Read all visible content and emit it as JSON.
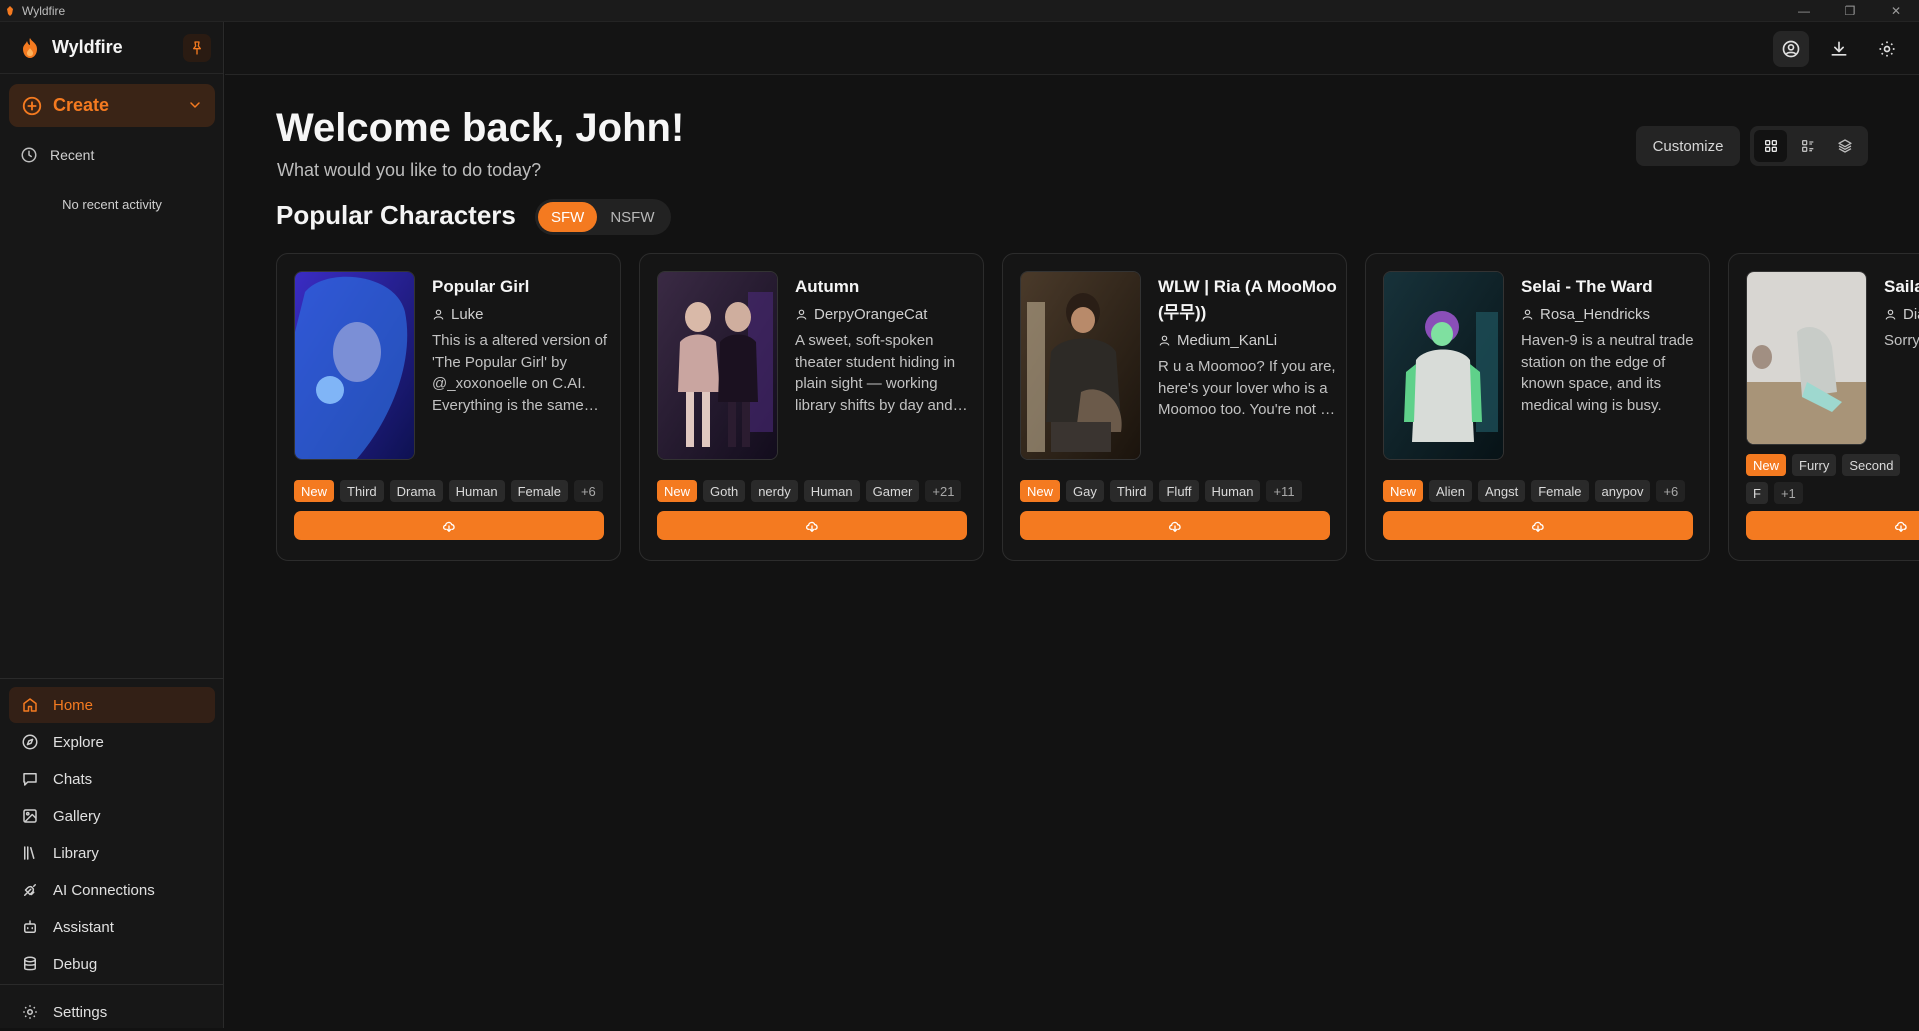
{
  "window": {
    "title": "Wyldfire",
    "controls": [
      "—",
      "❐",
      "✕"
    ]
  },
  "sidebar": {
    "brand": "Wyldfire",
    "create_label": "Create",
    "recent_label": "Recent",
    "no_recent": "No recent activity",
    "nav": [
      {
        "label": "Home",
        "icon": "home-icon",
        "active": true
      },
      {
        "label": "Explore",
        "icon": "compass-icon",
        "active": false
      },
      {
        "label": "Chats",
        "icon": "chat-icon",
        "active": false
      },
      {
        "label": "Gallery",
        "icon": "image-icon",
        "active": false
      },
      {
        "label": "Library",
        "icon": "library-icon",
        "active": false
      },
      {
        "label": "AI Connections",
        "icon": "plug-icon",
        "active": false
      },
      {
        "label": "Assistant",
        "icon": "bot-icon",
        "active": false
      },
      {
        "label": "Debug",
        "icon": "database-icon",
        "active": false
      }
    ],
    "settings_label": "Settings"
  },
  "main": {
    "welcome": "Welcome back, John!",
    "subtitle": "What would you like to do today?",
    "customize_label": "Customize",
    "section_title": "Popular Characters",
    "filters": {
      "sfw": "SFW",
      "nsfw": "NSFW",
      "active": "SFW"
    },
    "cards": [
      {
        "name": "Popular Girl",
        "author": "Luke",
        "description": "This is a altered version of 'The Popular Girl' by @_xoxonoelle on C.AI. Everything is the same otherwise.",
        "tags": [
          "New",
          "Third",
          "Drama",
          "Human",
          "Female",
          "+6"
        ]
      },
      {
        "name": "Autumn",
        "author": "DerpyOrangeCat",
        "description": "A sweet, soft-spoken theater student hiding in plain sight — working library shifts by day and more.",
        "tags": [
          "New",
          "Goth",
          "nerdy",
          "Human",
          "Gamer",
          "+21"
        ]
      },
      {
        "name": "WLW | Ria (A MooMoo (무무))",
        "author": "Medium_KanLi",
        "description": "R u a Moomoo? If you are, here's your lover who is a Moomoo too. You're not a Moomoo though.",
        "tags": [
          "New",
          "Gay",
          "Third",
          "Fluff",
          "Human",
          "+11"
        ]
      },
      {
        "name": "Selai - The Ward",
        "author": "Rosa_Hendricks",
        "description": "Haven-9 is a neutral trade station on the edge of known space, and its medical wing is busy.",
        "tags": [
          "New",
          "Alien",
          "Angst",
          "Female",
          "anypov",
          "+6"
        ]
      },
      {
        "name": "Saila rogu",
        "author": "Dia",
        "description": "Sorry defin the m and a",
        "tags": [
          "New",
          "Furry",
          "Second",
          "F",
          "+1"
        ]
      }
    ]
  },
  "colors": {
    "accent": "#f47a20",
    "bg": "#121212",
    "sidebar": "#171717"
  }
}
